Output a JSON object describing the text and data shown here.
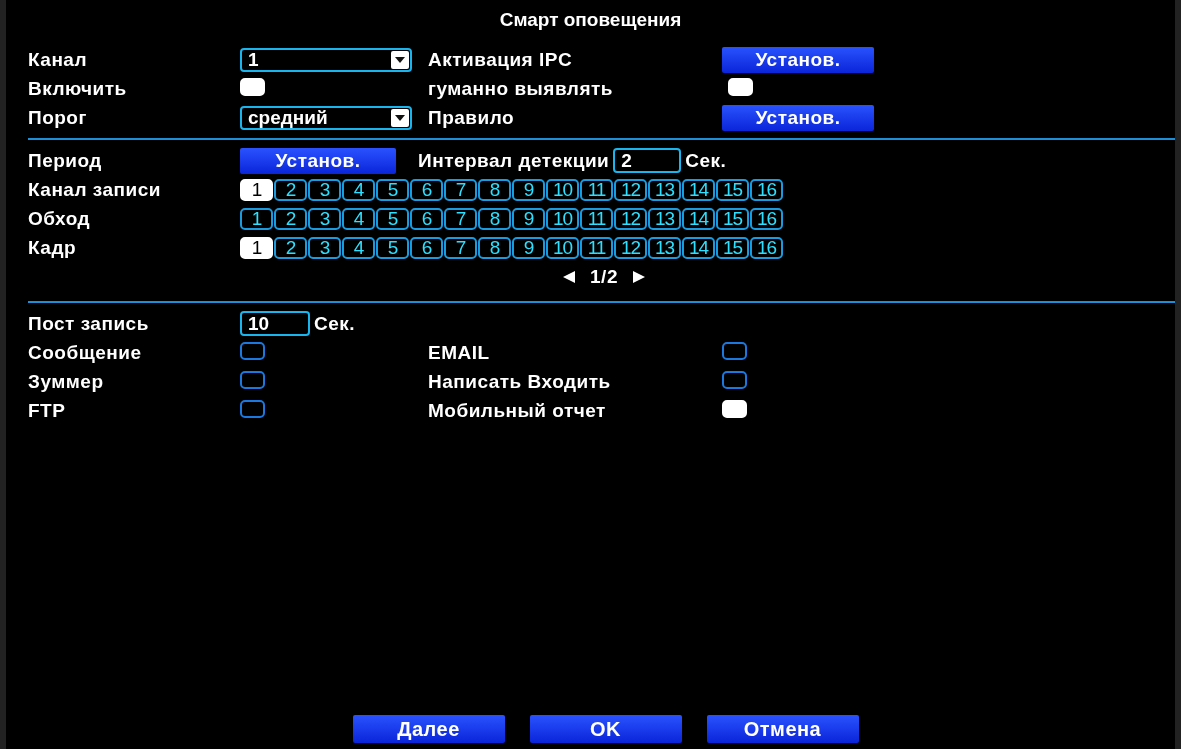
{
  "title": "Смарт оповещения",
  "channel": {
    "label": "Канал",
    "value": "1"
  },
  "ipc_activation": {
    "label": "Активация IPC",
    "button": "Установ."
  },
  "enable": {
    "label": "Включить",
    "checked": true
  },
  "human_detect": {
    "label": "гуманно выявлять",
    "checked": true
  },
  "threshold": {
    "label": "Порог",
    "value": "средний"
  },
  "rule": {
    "label": "Правило",
    "button": "Установ."
  },
  "period": {
    "label": "Период",
    "button": "Установ."
  },
  "detect_interval": {
    "label": "Интервал детекции",
    "value": "2",
    "unit": "Сек."
  },
  "channel_rows": [
    {
      "label": "Канал записи",
      "channels": [
        {
          "label": "1",
          "checked": true
        },
        {
          "label": "2",
          "checked": false
        },
        {
          "label": "3",
          "checked": false
        },
        {
          "label": "4",
          "checked": false
        },
        {
          "label": "5",
          "checked": false
        },
        {
          "label": "6",
          "checked": false
        },
        {
          "label": "7",
          "checked": false
        },
        {
          "label": "8",
          "checked": false
        },
        {
          "label": "9",
          "checked": false
        },
        {
          "label": "10",
          "checked": false
        },
        {
          "label": "11",
          "checked": false
        },
        {
          "label": "12",
          "checked": false
        },
        {
          "label": "13",
          "checked": false
        },
        {
          "label": "14",
          "checked": false
        },
        {
          "label": "15",
          "checked": false
        },
        {
          "label": "16",
          "checked": false
        }
      ]
    },
    {
      "label": "Обход",
      "channels": [
        {
          "label": "1",
          "checked": false
        },
        {
          "label": "2",
          "checked": false
        },
        {
          "label": "3",
          "checked": false
        },
        {
          "label": "4",
          "checked": false
        },
        {
          "label": "5",
          "checked": false
        },
        {
          "label": "6",
          "checked": false
        },
        {
          "label": "7",
          "checked": false
        },
        {
          "label": "8",
          "checked": false
        },
        {
          "label": "9",
          "checked": false
        },
        {
          "label": "10",
          "checked": false
        },
        {
          "label": "11",
          "checked": false
        },
        {
          "label": "12",
          "checked": false
        },
        {
          "label": "13",
          "checked": false
        },
        {
          "label": "14",
          "checked": false
        },
        {
          "label": "15",
          "checked": false
        },
        {
          "label": "16",
          "checked": false
        }
      ]
    },
    {
      "label": "Кадр",
      "channels": [
        {
          "label": "1",
          "checked": true
        },
        {
          "label": "2",
          "checked": false
        },
        {
          "label": "3",
          "checked": false
        },
        {
          "label": "4",
          "checked": false
        },
        {
          "label": "5",
          "checked": false
        },
        {
          "label": "6",
          "checked": false
        },
        {
          "label": "7",
          "checked": false
        },
        {
          "label": "8",
          "checked": false
        },
        {
          "label": "9",
          "checked": false
        },
        {
          "label": "10",
          "checked": false
        },
        {
          "label": "11",
          "checked": false
        },
        {
          "label": "12",
          "checked": false
        },
        {
          "label": "13",
          "checked": false
        },
        {
          "label": "14",
          "checked": false
        },
        {
          "label": "15",
          "checked": false
        },
        {
          "label": "16",
          "checked": false
        }
      ]
    }
  ],
  "pager": {
    "page": "1/2"
  },
  "post_record": {
    "label": "Пост запись",
    "value": "10",
    "unit": "Сек."
  },
  "actions_left": [
    {
      "label": "Сообщение",
      "checked": false
    },
    {
      "label": "Зуммер",
      "checked": false
    },
    {
      "label": "FTP",
      "checked": false
    }
  ],
  "actions_right": [
    {
      "label": "EMAIL",
      "checked": false
    },
    {
      "label": "Написать Входить",
      "checked": false
    },
    {
      "label": "Мобильный отчет",
      "checked": true
    }
  ],
  "buttons": [
    "Далее",
    "OK",
    "Отмена"
  ]
}
